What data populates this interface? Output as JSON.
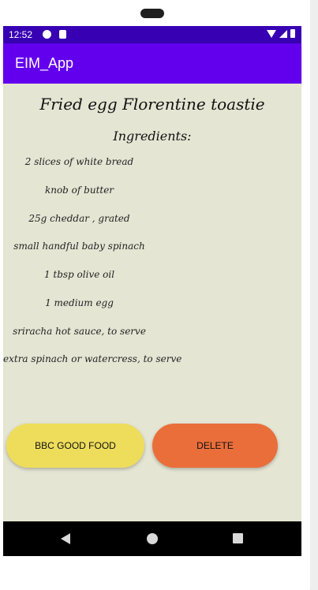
{
  "status_bar": {
    "time": "12:52"
  },
  "app_bar": {
    "title": "EIM_App"
  },
  "recipe": {
    "title": "Fried egg Florentine toastie",
    "ingredients_heading": "Ingredients:",
    "ingredients": [
      "2 slices of white bread",
      "knob of butter",
      "25g cheddar , grated",
      "small handful baby spinach",
      "1 tbsp olive oil",
      "1 medium egg",
      "sriracha hot sauce, to serve",
      "extra spinach or watercress, to serve"
    ]
  },
  "buttons": {
    "source_label": "BBC GOOD FOOD",
    "delete_label": "DELETE"
  },
  "colors": {
    "status_bar": "#3700b3",
    "app_bar": "#6200ee",
    "background": "#e5e5d4",
    "source_button": "#eedd5b",
    "delete_button": "#ea6e3a"
  },
  "icons": [
    "play-protect-icon",
    "sd-card-icon",
    "wifi-icon",
    "signal-icon",
    "battery-icon",
    "back-icon",
    "home-icon",
    "recents-icon"
  ]
}
